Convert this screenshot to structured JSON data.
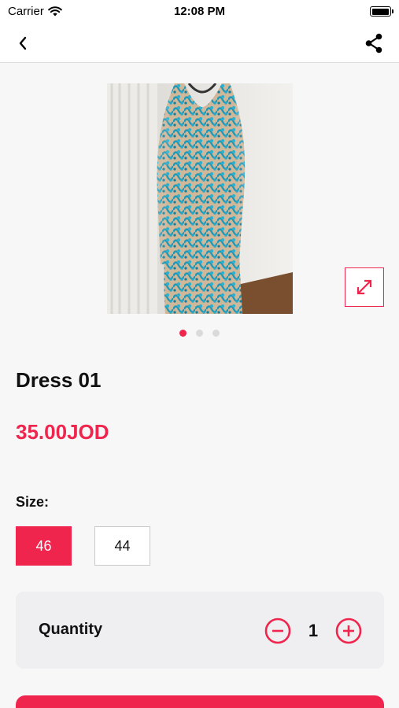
{
  "status_bar": {
    "carrier": "Carrier",
    "time": "12:08 PM",
    "battery_level": 1.0
  },
  "nav": {
    "back_icon": "chevron-left-icon",
    "share_icon": "share-icon"
  },
  "product": {
    "name": "Dress 01",
    "price": "35.00JOD",
    "image_count": 3,
    "active_image_index": 0
  },
  "size": {
    "label": "Size:",
    "options": [
      "46",
      "44"
    ],
    "selected": "46"
  },
  "quantity": {
    "label": "Quantity",
    "value": "1"
  },
  "colors": {
    "accent": "#f0254e",
    "background": "#f7f7f7",
    "card": "#efeff1"
  },
  "cta": {
    "label": ""
  }
}
